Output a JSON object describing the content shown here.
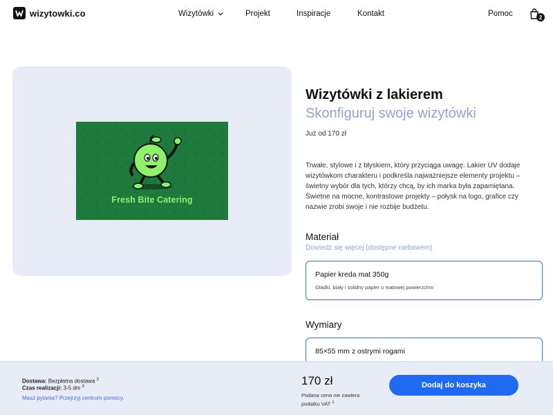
{
  "header": {
    "logo_text": "wizytowki.co",
    "nav": {
      "wizytowki": "Wizytówki",
      "projekt": "Projekt",
      "inspiracje": "Inspiracje",
      "kontakt": "Kontakt",
      "pomoc": "Pomoc"
    },
    "cart_count": "2"
  },
  "preview": {
    "card_text": "Fresh Bite Catering",
    "card_bg": "#1f7a3d",
    "card_accent": "#8ff06b"
  },
  "product": {
    "title": "Wizytówki z lakierem",
    "subtitle": "Skonfiguruj swoje wizytówki",
    "price_from": "Już od 170 zł",
    "description": "Trwałe, stylowe i z błyskiem, który przyciąga uwagę. Lakier UV dodaje wizytówkom charakteru i podkreśla najważniejsze elementy projektu – świetny wybór dla tych, którzy chcą, by ich marka była zapamiętana. Świetne na mocne, kontrastowe projekty – połysk na logo, grafice czy nazwie zrobi swoje i nie rozbije budżetu."
  },
  "material": {
    "title": "Materiał",
    "learn_more": "Dowiedz się więcej (dostępne niebawem)",
    "option_name": "Papier kreda mat 350g",
    "option_desc": "Gładki, biały i solidny papier o matowej powierzchni"
  },
  "dimensions": {
    "title": "Wymiary",
    "option_name": "85×55 mm z ostrymi rogami"
  },
  "bottom_bar": {
    "delivery_label": "Dostawa:",
    "delivery_value": "Bezpłatna dostawa",
    "delivery_note": "2",
    "time_label": "Czas realizacji:",
    "time_value": "3-5 dni",
    "time_note": "3",
    "help_link": "Masz pytania? Przejrzyj centrum pomocy.",
    "total": "170 zł",
    "vat_note": "Podana cena nie zawiera podatku VAT",
    "vat_note_ref": "1",
    "add_to_cart": "Dodaj do koszyka"
  },
  "colors": {
    "accent": "#1f6af0",
    "muted_blue": "#8fa3d3",
    "panel_bg": "#e8ecf6"
  }
}
